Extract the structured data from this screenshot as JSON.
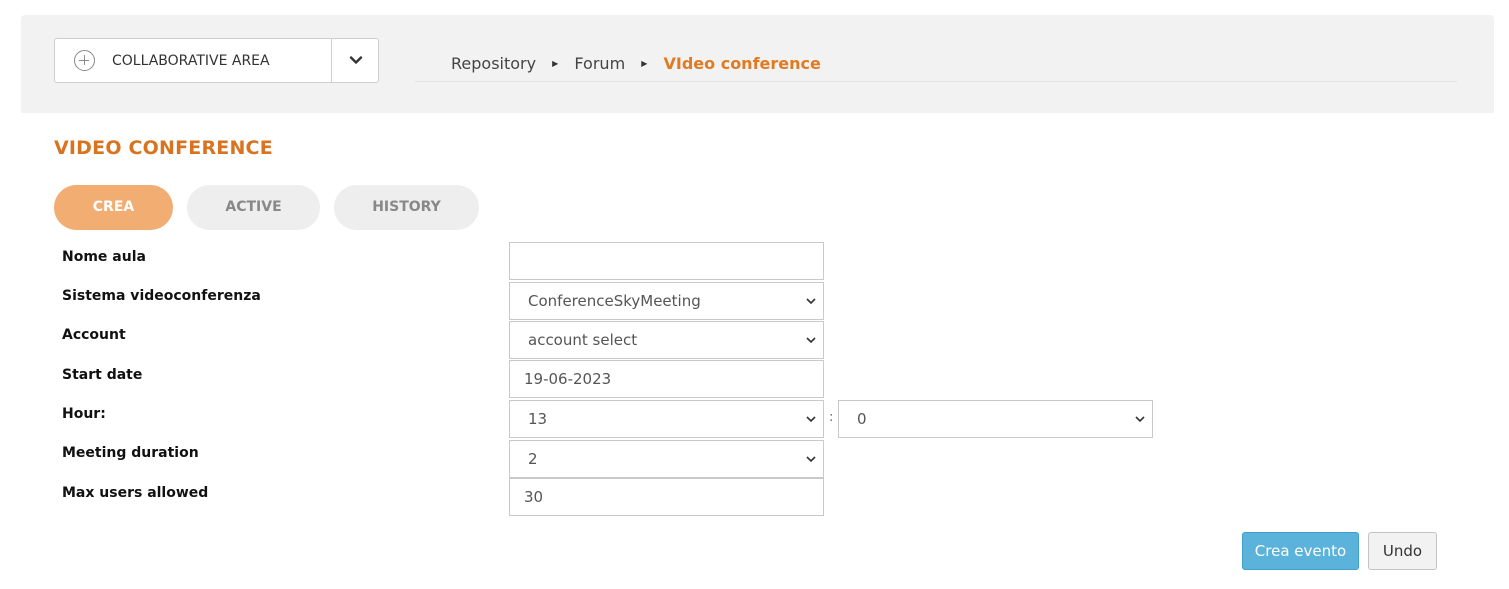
{
  "header": {
    "area_selector": {
      "label": "COLLABORATIVE AREA"
    },
    "breadcrumb": {
      "items": [
        "Repository",
        "Forum"
      ],
      "current": "VIdeo conference"
    }
  },
  "page": {
    "title": "VIDEO CONFERENCE",
    "tabs": [
      "CREA",
      "ACTIVE",
      "HISTORY"
    ],
    "active_tab": "CREA"
  },
  "form": {
    "nome_aula": {
      "label": "Nome aula",
      "value": ""
    },
    "sistema": {
      "label": "Sistema videoconferenza",
      "value": "ConferenceSkyMeeting"
    },
    "account": {
      "label": "Account",
      "value": "account select"
    },
    "start_date": {
      "label": "Start date",
      "value": "19-06-2023"
    },
    "hour": {
      "label": "Hour:",
      "hour_value": "13",
      "separator": ":",
      "minute_value": "0"
    },
    "duration": {
      "label": "Meeting duration",
      "value": "2"
    },
    "max_users": {
      "label": "Max users allowed",
      "value": "30"
    }
  },
  "actions": {
    "create_label": "Crea evento",
    "undo_label": "Undo"
  },
  "colors": {
    "accent_orange": "#d9731f",
    "active_tab": "#f2ad73",
    "primary_button": "#5bb3dc",
    "header_bg": "#f2f2f2"
  },
  "icons": {
    "area_selector": "plus-circle-icon",
    "area_dropdown": "chevron-down-icon",
    "breadcrumb_separator": "caret-right-icon",
    "select_caret": "chevron-down-icon"
  }
}
